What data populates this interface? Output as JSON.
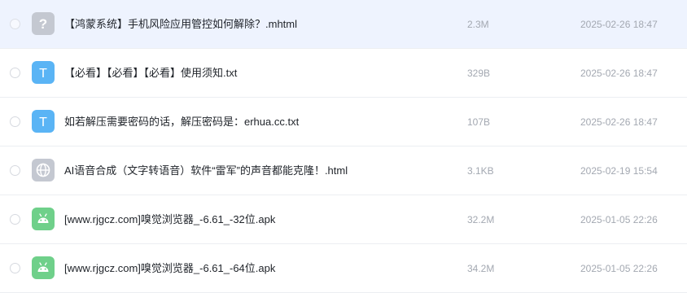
{
  "files": [
    {
      "name": "【鸿蒙系统】手机风险应用管控如何解除？.mhtml",
      "size": "2.3M",
      "date": "2025-02-26 18:47",
      "icon": "unknown-file-icon",
      "selected": true
    },
    {
      "name": "【必看】【必看】【必看】使用须知.txt",
      "size": "329B",
      "date": "2025-02-26 18:47",
      "icon": "text-file-icon",
      "selected": false
    },
    {
      "name": "如若解压需要密码的话，解压密码是：erhua.cc.txt",
      "size": "107B",
      "date": "2025-02-26 18:47",
      "icon": "text-file-icon",
      "selected": false
    },
    {
      "name": "AI语音合成（文字转语音）软件“雷军”的声音都能克隆！.html",
      "size": "3.1KB",
      "date": "2025-02-19 15:54",
      "icon": "web-file-icon",
      "selected": false
    },
    {
      "name": "[www.rjgcz.com]嗅觉浏览器_-6.61_-32位.apk",
      "size": "32.2M",
      "date": "2025-01-05 22:26",
      "icon": "android-apk-icon",
      "selected": false
    },
    {
      "name": "[www.rjgcz.com]嗅觉浏览器_-6.61_-64位.apk",
      "size": "34.2M",
      "date": "2025-01-05 22:26",
      "icon": "android-apk-icon",
      "selected": false
    }
  ],
  "colors": {
    "selected_row_bg": "#eef3fe",
    "text_icon": "#5ab4f5",
    "apk_icon": "#6fd08a",
    "unknown_icon": "#c4c8d1",
    "web_icon": "#c4c8d1"
  }
}
